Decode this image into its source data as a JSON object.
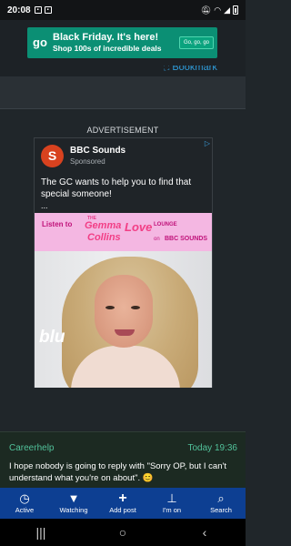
{
  "status_bar": {
    "time": "20:08",
    "right_icons": [
      "mute-icon",
      "wifi-icon",
      "signal-icon",
      "battery-icon"
    ]
  },
  "top_ad": {
    "logo": "go",
    "headline": "Black Friday. It's here!",
    "subline": "Shop 100s of incredible deals",
    "button_label": "Go, go, go",
    "color": "#0b8f74"
  },
  "bookmark": {
    "label": "Bookmark"
  },
  "advertisement": {
    "label": "ADVERTISEMENT",
    "sponsor_name": "BBC Sounds",
    "sponsor_tag": "Sponsored",
    "body": "The GC wants to help you to find that special someone!",
    "ellipsis": "...",
    "banner": {
      "listen": "Listen to",
      "the": "THE",
      "gemma": "Gemma",
      "collins": "Collins",
      "love": "Love",
      "lounge": "LOUNGE",
      "on": "on",
      "bbc_sounds": "BBC SOUNDS"
    },
    "photo_word": "blu"
  },
  "post": {
    "author": "Careerhelp",
    "time": "Today 19:36",
    "body": "I hope nobody is going to reply with \"Sorry OP, but I can't understand what you're on about\". 😊"
  },
  "bottom_nav": {
    "items": [
      {
        "label": "Active",
        "icon": "clock-icon"
      },
      {
        "label": "Watching",
        "icon": "filter-icon"
      },
      {
        "label": "Add post",
        "icon": "plus-icon"
      },
      {
        "label": "I'm on",
        "icon": "pin-icon"
      },
      {
        "label": "Search",
        "icon": "search-icon"
      }
    ],
    "color": "#0d3f92"
  }
}
